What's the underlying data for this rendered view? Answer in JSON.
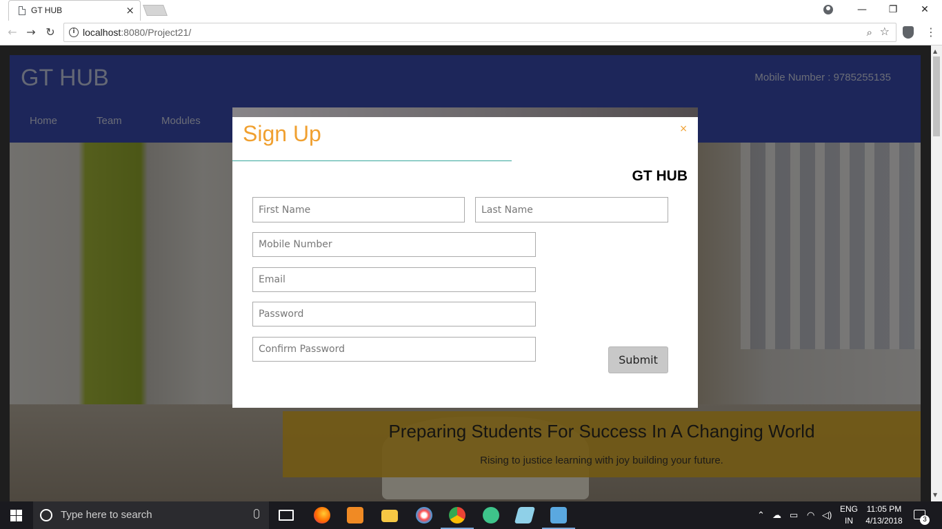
{
  "browser": {
    "tab_title": "GT HUB",
    "tab_close": "×",
    "url_host": "localhost",
    "url_rest": ":8080/Project21/",
    "minimize": "—",
    "restore": "❐",
    "close": "✕"
  },
  "site": {
    "brand": "GT HUB",
    "mobile_label": "Mobile Number : 9785255135",
    "nav": [
      "Home",
      "Team",
      "Modules"
    ],
    "banner_heading": "Preparing Students For Success In A Changing World",
    "banner_sub": "Rising to justice learning with joy building your future."
  },
  "modal": {
    "title": "Sign Up",
    "close": "×",
    "brand": "GT HUB",
    "fields": {
      "first_name": "First Name",
      "last_name": "Last Name",
      "mobile": "Mobile Number",
      "email": "Email",
      "password": "Password",
      "confirm_password": "Confirm Password"
    },
    "submit": "Submit"
  },
  "taskbar": {
    "search_placeholder": "Type here to search",
    "lang_top": "ENG",
    "lang_bottom": "IN",
    "time": "11:05 PM",
    "date": "4/13/2018",
    "notification_count": "3",
    "apps": [
      "task-view",
      "firefox",
      "media-player",
      "file-explorer",
      "paint",
      "chrome",
      "atom",
      "notepad",
      "virtualbox"
    ]
  },
  "colors": {
    "header_bg": "#3a4cb4",
    "modal_title": "#f0a030",
    "modal_rule": "#35a59b",
    "banner": "#e4b228"
  }
}
